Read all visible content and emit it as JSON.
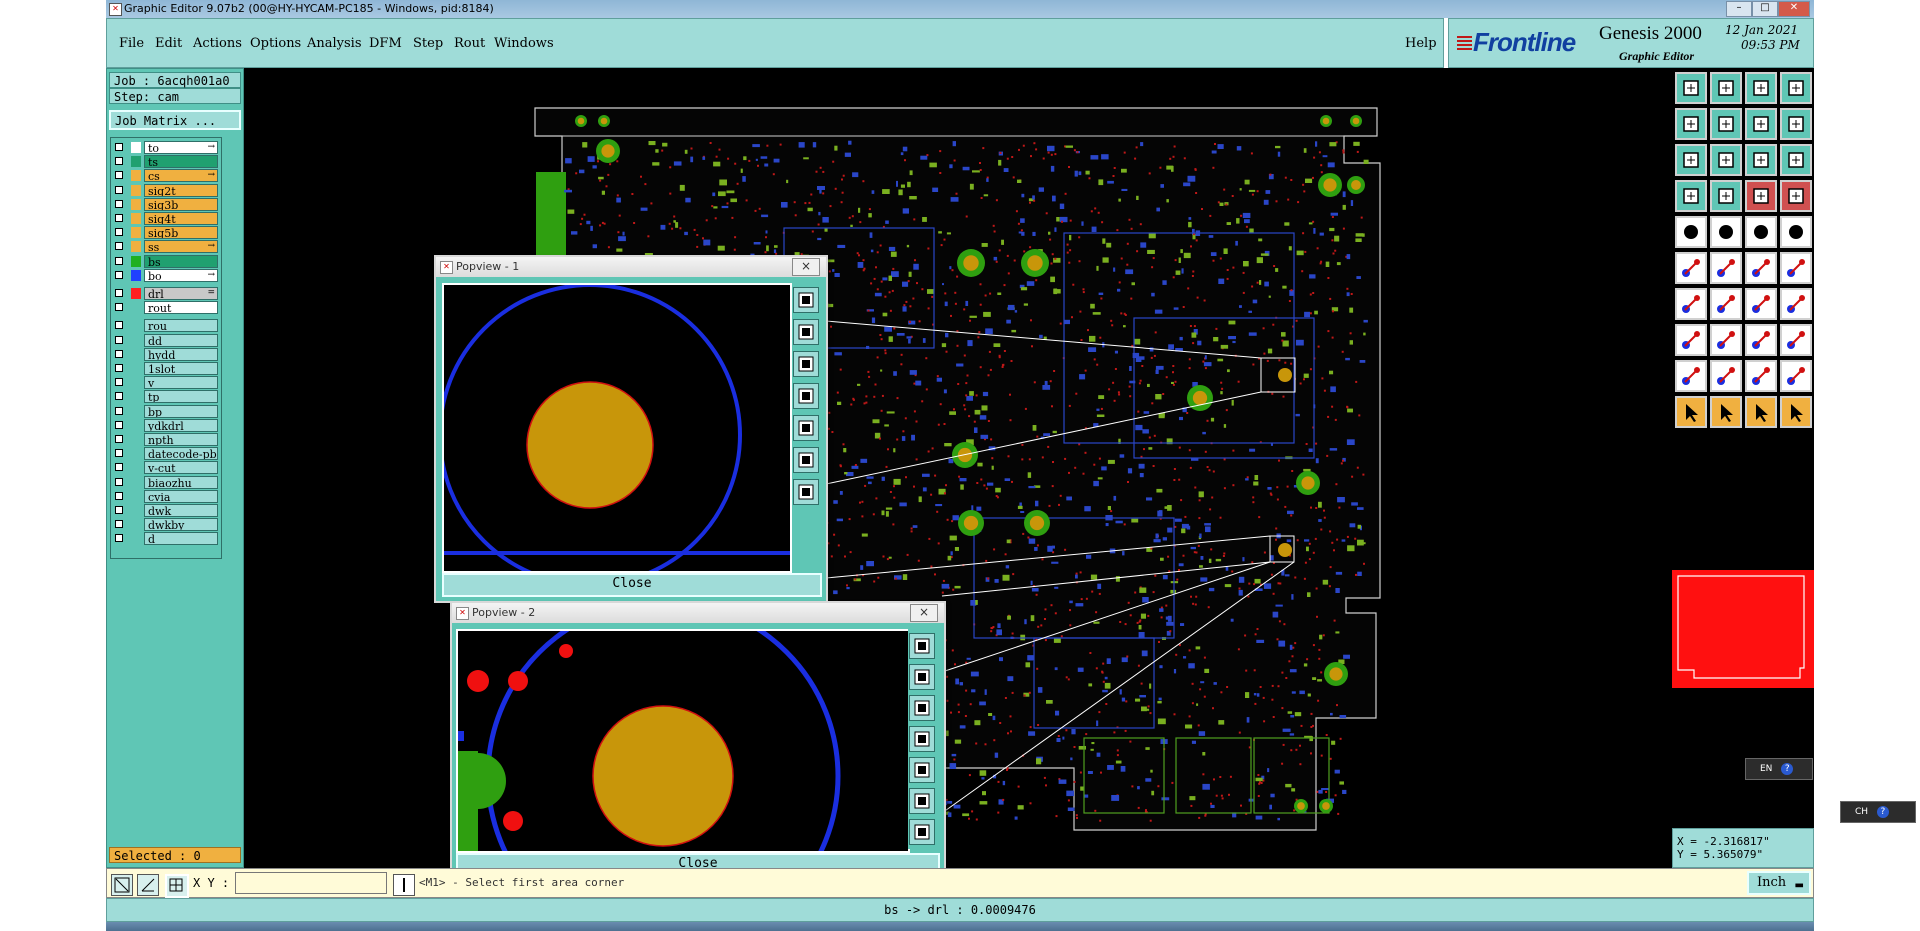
{
  "window": {
    "title": "Graphic Editor 9.07b2 (00@HY-HYCAM-PC185 - Windows, pid:8184)"
  },
  "menu": {
    "items": [
      "File",
      "Edit",
      "Actions",
      "Options",
      "Analysis",
      "DFM",
      "Step",
      "Rout",
      "Windows"
    ],
    "help": "Help"
  },
  "branding": {
    "logo": "Frontline",
    "product": "Genesis 2000",
    "subtitle": "Graphic Editor",
    "date": "12 Jan 2021",
    "time": "09:53 PM"
  },
  "job": {
    "job_label": "Job : 6acqh001a0",
    "step_label": "Step: cam",
    "matrix_button": "Job Matrix ...",
    "selected": "Selected : 0"
  },
  "layers": [
    {
      "name": "to",
      "color": "#ffffff",
      "bg": "#ffffff",
      "mark": "→"
    },
    {
      "name": "ts",
      "color": "#20a070",
      "bg": "#20a070",
      "mark": ""
    },
    {
      "name": "cs",
      "color": "#f0b040",
      "bg": "#f0b040",
      "mark": "→"
    },
    {
      "name": "sig2t",
      "color": "#f0b040",
      "bg": "#f0b040",
      "mark": ""
    },
    {
      "name": "sig3b",
      "color": "#f0b040",
      "bg": "#f0b040",
      "mark": ""
    },
    {
      "name": "sig4t",
      "color": "#f0b040",
      "bg": "#f0b040",
      "mark": ""
    },
    {
      "name": "sig5b",
      "color": "#f0b040",
      "bg": "#f0b040",
      "mark": ""
    },
    {
      "name": "ss",
      "color": "#f0b040",
      "bg": "#f0b040",
      "mark": "→"
    },
    {
      "name": "bs",
      "color": "#20b020",
      "bg": "#20a070",
      "mark": ""
    },
    {
      "name": "bo",
      "color": "#2040ff",
      "bg": "#ffffff",
      "mark": "→"
    },
    {
      "name": "drl",
      "color": "#ff2020",
      "bg": "#c8c8c8",
      "mark": "="
    },
    {
      "name": "rout",
      "color": "#000000",
      "bg": "#ffffff",
      "mark": ""
    },
    {
      "name": "rou",
      "color": "#000000",
      "bg": "#9fdcd8",
      "mark": ""
    },
    {
      "name": "dd",
      "color": "#000000",
      "bg": "#9fdcd8",
      "mark": ""
    },
    {
      "name": "hydd",
      "color": "#000000",
      "bg": "#9fdcd8",
      "mark": ""
    },
    {
      "name": "1slot",
      "color": "#000000",
      "bg": "#9fdcd8",
      "mark": ""
    },
    {
      "name": "v",
      "color": "#000000",
      "bg": "#9fdcd8",
      "mark": ""
    },
    {
      "name": "tp",
      "color": "#000000",
      "bg": "#9fdcd8",
      "mark": ""
    },
    {
      "name": "bp",
      "color": "#000000",
      "bg": "#9fdcd8",
      "mark": ""
    },
    {
      "name": "ydkdrl",
      "color": "#000000",
      "bg": "#9fdcd8",
      "mark": ""
    },
    {
      "name": "npth",
      "color": "#000000",
      "bg": "#9fdcd8",
      "mark": ""
    },
    {
      "name": "datecode-pbe",
      "color": "#000000",
      "bg": "#9fdcd8",
      "mark": ""
    },
    {
      "name": "v-cut",
      "color": "#000000",
      "bg": "#9fdcd8",
      "mark": ""
    },
    {
      "name": "biaozhu",
      "color": "#000000",
      "bg": "#9fdcd8",
      "mark": ""
    },
    {
      "name": "cvia",
      "color": "#000000",
      "bg": "#9fdcd8",
      "mark": ""
    },
    {
      "name": "dwk",
      "color": "#000000",
      "bg": "#9fdcd8",
      "mark": ""
    },
    {
      "name": "dwkby",
      "color": "#000000",
      "bg": "#9fdcd8",
      "mark": ""
    },
    {
      "name": "d",
      "color": "#000000",
      "bg": "#9fdcd8",
      "mark": ""
    }
  ],
  "popview1": {
    "title": "Popview - 1",
    "close": "Close",
    "x": "×"
  },
  "popview2": {
    "title": "Popview - 2",
    "close": "Close",
    "x": "×"
  },
  "coords": {
    "x": "X = -2.316817\"",
    "y": "Y = 5.365079\""
  },
  "bottom": {
    "xy_label": "X Y :",
    "xy_value": "",
    "prompt": "<M1> - Select first area corner",
    "units": "Inch"
  },
  "status": {
    "text": "bs -> drl : 0.0009476"
  },
  "taskbar": {
    "lang1": "EN",
    "lang2": "CH"
  },
  "colors": {
    "panel": "#5fc6b5",
    "menu": "#9fdcd8",
    "canvas": "#000000",
    "highlight": "#ff0000"
  }
}
